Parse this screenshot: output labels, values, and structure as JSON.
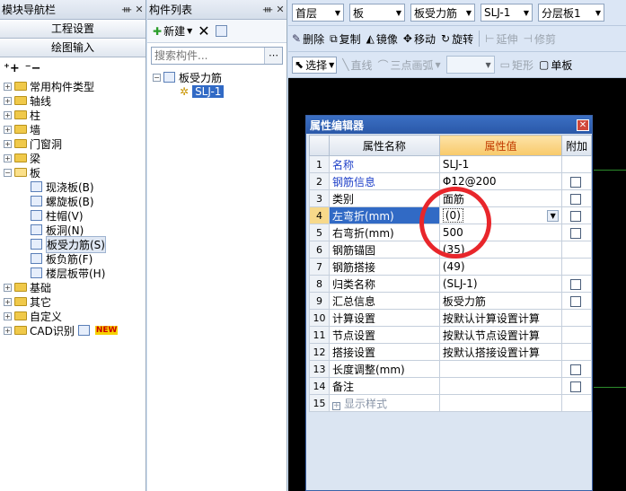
{
  "nav": {
    "title": "模块导航栏",
    "btn_engineering": "工程设置",
    "btn_drawing": "绘图输入",
    "items": [
      {
        "label": "常用构件类型",
        "state": "+"
      },
      {
        "label": "轴线",
        "state": "+"
      },
      {
        "label": "柱",
        "state": "+"
      },
      {
        "label": "墙",
        "state": "+"
      },
      {
        "label": "门窗洞",
        "state": "+"
      },
      {
        "label": "梁",
        "state": "+"
      },
      {
        "label": "板",
        "state": "-"
      }
    ],
    "board_children": [
      "现浇板(B)",
      "螺旋板(B)",
      "柱帽(V)",
      "板洞(N)",
      "板受力筋(S)",
      "板负筋(F)",
      "楼层板带(H)"
    ],
    "items_after": [
      {
        "label": "基础",
        "state": "+"
      },
      {
        "label": "其它",
        "state": "+"
      },
      {
        "label": "自定义",
        "state": "+"
      },
      {
        "label": "CAD识别",
        "state": "+"
      }
    ],
    "new_badge": "NEW"
  },
  "comp": {
    "title": "构件列表",
    "new_label": "新建",
    "search_placeholder": "搜索构件...",
    "tree_parent": "板受力筋",
    "tree_child": "SLJ-1"
  },
  "toolbar": {
    "floor": "首层",
    "type": "板",
    "subtype": "板受力筋",
    "component": "SLJ-1",
    "layer": "分层板1",
    "delete": "删除",
    "copy": "复制",
    "mirror": "镜像",
    "move": "移动",
    "rotate": "旋转",
    "extend": "延伸",
    "trim": "修剪",
    "select": "选择",
    "line": "直线",
    "arc": "三点画弧",
    "rect": "矩形",
    "single": "单板"
  },
  "prop": {
    "title": "属性编辑器",
    "col_name": "属性名称",
    "col_value": "属性值",
    "col_add": "附加",
    "rows": [
      {
        "n": "1",
        "name": "名称",
        "value": "SLJ-1"
      },
      {
        "n": "2",
        "name": "钢筋信息",
        "value": "Φ12@200"
      },
      {
        "n": "3",
        "name": "类别",
        "value": "面筋"
      },
      {
        "n": "4",
        "name": "左弯折(mm)",
        "value": "(0)"
      },
      {
        "n": "5",
        "name": "右弯折(mm)",
        "value": "500"
      },
      {
        "n": "6",
        "name": "钢筋锚固",
        "value": "(35)"
      },
      {
        "n": "7",
        "name": "钢筋搭接",
        "value": "(49)"
      },
      {
        "n": "8",
        "name": "归类名称",
        "value": "(SLJ-1)"
      },
      {
        "n": "9",
        "name": "汇总信息",
        "value": "板受力筋"
      },
      {
        "n": "10",
        "name": "计算设置",
        "value": "按默认计算设置计算"
      },
      {
        "n": "11",
        "name": "节点设置",
        "value": "按默认节点设置计算"
      },
      {
        "n": "12",
        "name": "搭接设置",
        "value": "按默认搭接设置计算"
      },
      {
        "n": "13",
        "name": "长度调整(mm)",
        "value": ""
      },
      {
        "n": "14",
        "name": "备注",
        "value": ""
      },
      {
        "n": "15",
        "name": "显示样式",
        "value": ""
      }
    ]
  }
}
